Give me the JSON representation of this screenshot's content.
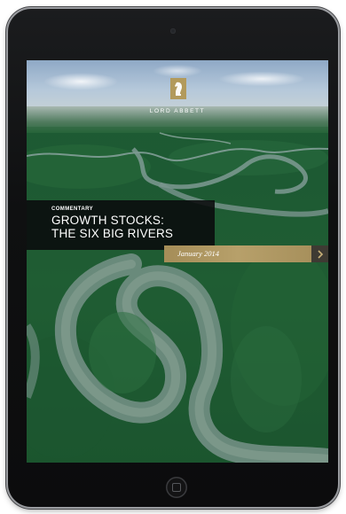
{
  "cover": {
    "brand": "LORD ABBETT",
    "kicker": "COMMENTARY",
    "headline_line1": "GROWTH STOCKS:",
    "headline_line2": "THE SIX BIG RIVERS",
    "date": "January 2014"
  },
  "icons": {
    "logo": "knight-chess-icon",
    "next": "chevron-right-icon",
    "home": "home-button-icon"
  },
  "colors": {
    "gold_accent": "#b29a5c",
    "title_panel": "#0a0a0c",
    "forest": "#1e5a33",
    "river": "#6d8a78",
    "device_bezel": "#111213"
  }
}
